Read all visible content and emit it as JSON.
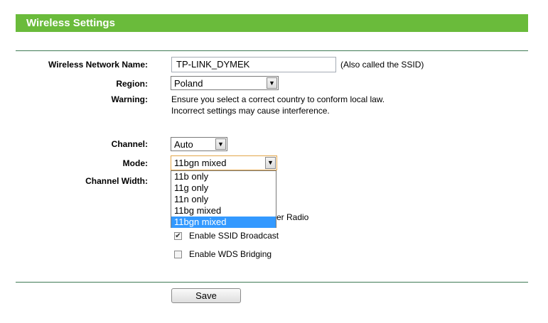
{
  "header": {
    "title": "Wireless Settings"
  },
  "form": {
    "network_name_label": "Wireless Network Name:",
    "network_name_value": "TP-LINK_DYMEK",
    "ssid_note": "(Also called the SSID)",
    "region_label": "Region:",
    "region_value": "Poland",
    "warning_label": "Warning:",
    "warning_line1": "Ensure you select a correct country to conform local law.",
    "warning_line2": "Incorrect settings may cause interference.",
    "channel_label": "Channel:",
    "channel_value": "Auto",
    "mode_label": "Mode:",
    "mode_value": "11bgn mixed",
    "mode_options": [
      "11b only",
      "11g only",
      "11n only",
      "11bg mixed",
      "11bgn mixed"
    ],
    "channel_width_label": "Channel Width:",
    "router_radio_partial": "er Radio",
    "ssid_broadcast_label": "Enable SSID Broadcast",
    "ssid_broadcast_checked": true,
    "wds_label": "Enable WDS Bridging",
    "wds_checked": false,
    "save_label": "Save"
  },
  "colors": {
    "header": "#6abb3b",
    "divider": "#3f7a55",
    "selected": "#3399ff"
  }
}
